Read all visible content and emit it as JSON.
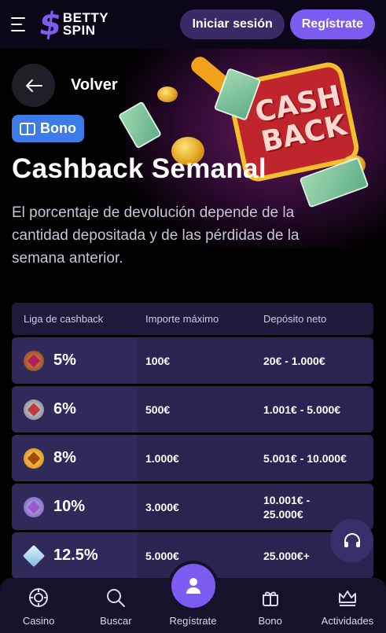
{
  "header": {
    "logo_top": "BETTY",
    "logo_bottom": "SPIN",
    "login_label": "Iniciar sesión",
    "register_label": "Regístrate"
  },
  "hero": {
    "back_label": "Volver",
    "badge_label": "Bono",
    "title": "Cashback Semanal",
    "description": "El porcentaje de devolución depende de la cantidad depositada y de las pérdidas de la semana anterior.",
    "art_text_line1": "CASH",
    "art_text_line2": "BACK"
  },
  "table": {
    "headers": [
      "Liga de cashback",
      "Importe máximo",
      "Depósito neto"
    ],
    "rows": [
      {
        "icon": "bronze-gem-icon",
        "percent": "5%",
        "max": "100€",
        "deposit": "20€ - 1.000€"
      },
      {
        "icon": "silver-gem-icon",
        "percent": "6%",
        "max": "500€",
        "deposit": "1.001€ - 5.000€"
      },
      {
        "icon": "gold-gem-icon",
        "percent": "8%",
        "max": "1.000€",
        "deposit": "5.001€ - 10.000€"
      },
      {
        "icon": "purple-gem-icon",
        "percent": "10%",
        "max": "3.000€",
        "deposit": "10.001€ - 25.000€"
      },
      {
        "icon": "diamond-icon",
        "percent": "12.5%",
        "max": "5.000€",
        "deposit": "25.000€+"
      }
    ]
  },
  "bottom_nav": {
    "items": [
      "Casino",
      "Buscar",
      "Regístrate",
      "Bono",
      "Actividades"
    ]
  },
  "colors": {
    "accent": "#7c5cf0",
    "badge": "#3d7be8",
    "table_row": "#2a2450",
    "background": "#000000"
  }
}
